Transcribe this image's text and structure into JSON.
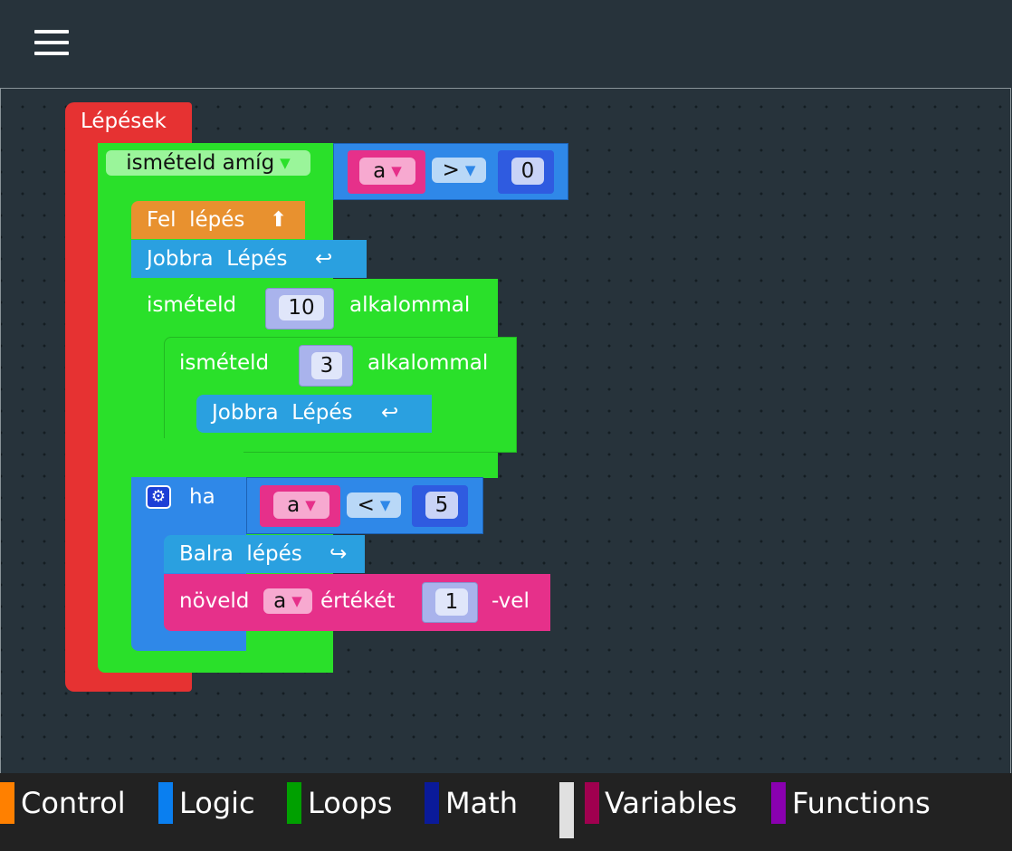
{
  "menu": {
    "icon": "hamburger-menu-icon"
  },
  "blocks": {
    "steps_label": "Lépések",
    "repeat_while": {
      "label": "ismételd  amíg",
      "condition": {
        "var": "a",
        "op": ">",
        "value": "0"
      }
    },
    "up_step": {
      "label": "Fel  lépés",
      "icon": "⬆"
    },
    "right_step_1": {
      "label": "Jobbra  Lépés",
      "icon": "↩"
    },
    "repeat_outer": {
      "label_before": "ismételd",
      "count": "10",
      "label_after": "alkalommal"
    },
    "repeat_inner": {
      "label_before": "ismételd",
      "count": "3",
      "label_after": "alkalommal"
    },
    "right_step_2": {
      "label": "Jobbra  Lépés",
      "icon": "↩"
    },
    "if_block": {
      "label": "ha",
      "gear_icon": "gear-icon",
      "condition": {
        "var": "a",
        "op": "<",
        "value": "5"
      }
    },
    "left_step": {
      "label": "Balra  lépés",
      "icon": "↪"
    },
    "increment": {
      "label_before": "növeld",
      "var": "a",
      "label_middle": "értékét",
      "value": "1",
      "label_after": "-vel"
    }
  },
  "legend": [
    {
      "label": "Control",
      "color": "#ff8000"
    },
    {
      "label": "Logic",
      "color": "#0a7ff0"
    },
    {
      "label": "Loops",
      "color": "#00a000"
    },
    {
      "label": "Math",
      "color": "#0a1a9a"
    },
    {
      "label": "",
      "color": "#e0e0e0"
    },
    {
      "label": "Variables",
      "color": "#a0004f"
    },
    {
      "label": "Functions",
      "color": "#8a00b0"
    }
  ],
  "colors": {
    "event": "#e63232",
    "loop": "#2ae02a",
    "logic": "#2f88e8",
    "motion_up": "#e8912f",
    "motion": "#2aa0e0",
    "variable": "#e6308a",
    "math": "#2f5be0"
  }
}
